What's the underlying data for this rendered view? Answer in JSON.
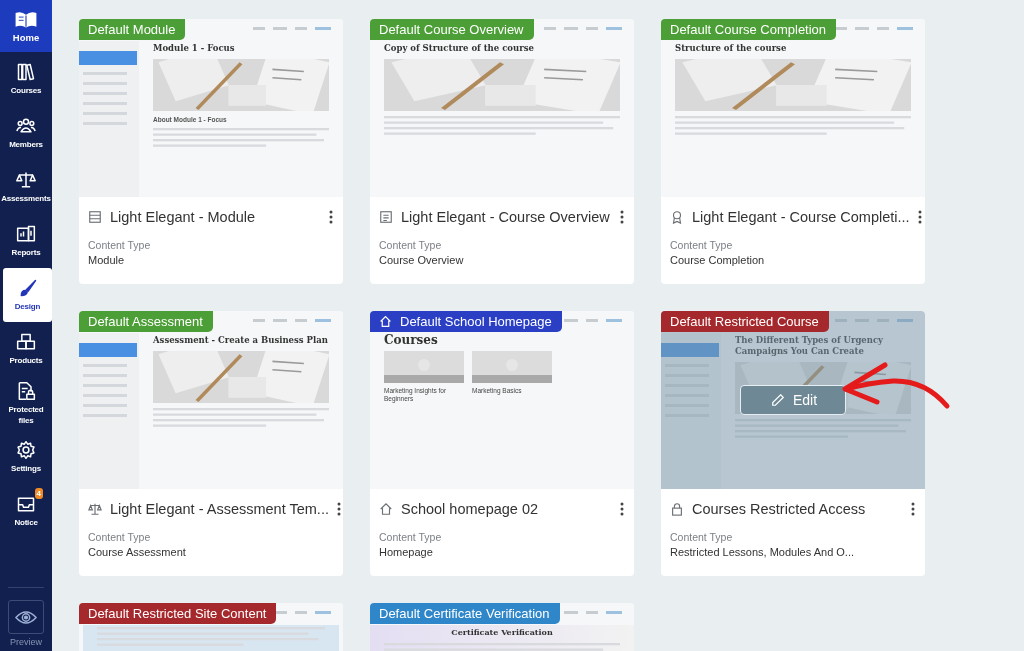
{
  "sidebar": {
    "home": {
      "label": "Home"
    },
    "items": [
      {
        "label": "Courses",
        "selected": false
      },
      {
        "label": "Members",
        "selected": false
      },
      {
        "label": "Assessments",
        "selected": false
      },
      {
        "label": "Reports",
        "selected": false
      },
      {
        "label": "Design",
        "selected": true
      },
      {
        "label": "Products",
        "selected": false
      },
      {
        "label": "Protected files",
        "selected": false
      },
      {
        "label": "Settings",
        "selected": false
      },
      {
        "label": "Notice",
        "selected": false,
        "badge": "4"
      }
    ],
    "preview": {
      "label": "Preview"
    }
  },
  "cards": [
    {
      "kind": "module",
      "badge": {
        "label": "Default Module",
        "color": "#4c9e36",
        "home_icon": false
      },
      "preview": {
        "kind": "sidebar",
        "heading": "Module 1 - Focus",
        "subheading": "About Module 1 - Focus",
        "photo": true
      },
      "title": "Light Elegant - Module",
      "content_type_label": "Content Type",
      "content_type": "Module",
      "hovered": false
    },
    {
      "kind": "overview",
      "badge": {
        "label": "Default Course Overview",
        "color": "#4c9e36",
        "home_icon": false
      },
      "preview": {
        "kind": "plain",
        "heading": "Copy of Structure of the course",
        "photo": true
      },
      "title": "Light Elegant - Course Overview",
      "content_type_label": "Content Type",
      "content_type": "Course Overview",
      "hovered": false
    },
    {
      "kind": "completion",
      "badge": {
        "label": "Default Course Completion",
        "color": "#4c9e36",
        "home_icon": false
      },
      "preview": {
        "kind": "plain",
        "heading": "Structure of the course",
        "photo": true
      },
      "title": "Light Elegant - Course Completi...",
      "content_type_label": "Content Type",
      "content_type": "Course Completion",
      "hovered": false
    },
    {
      "kind": "assessment",
      "badge": {
        "label": "Default Assessment",
        "color": "#4c9e36",
        "home_icon": false
      },
      "preview": {
        "kind": "sidebar",
        "heading": "Assessment - Create a Business Plan",
        "photo": true
      },
      "title": "Light Elegant - Assessment Tem...",
      "content_type_label": "Content Type",
      "content_type": "Course Assessment",
      "hovered": false
    },
    {
      "kind": "homepage",
      "badge": {
        "label": "Default School Homepage",
        "color": "#2a3fc4",
        "home_icon": true
      },
      "preview": {
        "kind": "courses",
        "heading": "Courses",
        "courses": [
          "Marketing Insights for Beginners",
          "Marketing Basics"
        ]
      },
      "title": "School homepage 02",
      "content_type_label": "Content Type",
      "content_type": "Homepage",
      "hovered": false
    },
    {
      "kind": "restricted",
      "badge": {
        "label": "Default Restricted Course",
        "color": "#a4282c",
        "home_icon": false
      },
      "preview": {
        "kind": "sidebar",
        "heading": "The Different Types of Urgency Campaigns You Can Create",
        "photo": true
      },
      "title": "Courses Restricted Access",
      "content_type_label": "Content Type",
      "content_type": "Restricted Lessons, Modules And O...",
      "hovered": true,
      "edit_label": "Edit"
    },
    {
      "badge": {
        "label": "Default Restricted Site Content",
        "color": "#a4282c",
        "home_icon": false
      },
      "preview": {
        "kind": "banner"
      },
      "hovered": false
    },
    {
      "badge": {
        "label": "Default Certificate Verification",
        "color": "#2f86c9",
        "home_icon": false
      },
      "preview": {
        "kind": "certificate",
        "heading": "Certificate Verification"
      },
      "hovered": false
    }
  ]
}
